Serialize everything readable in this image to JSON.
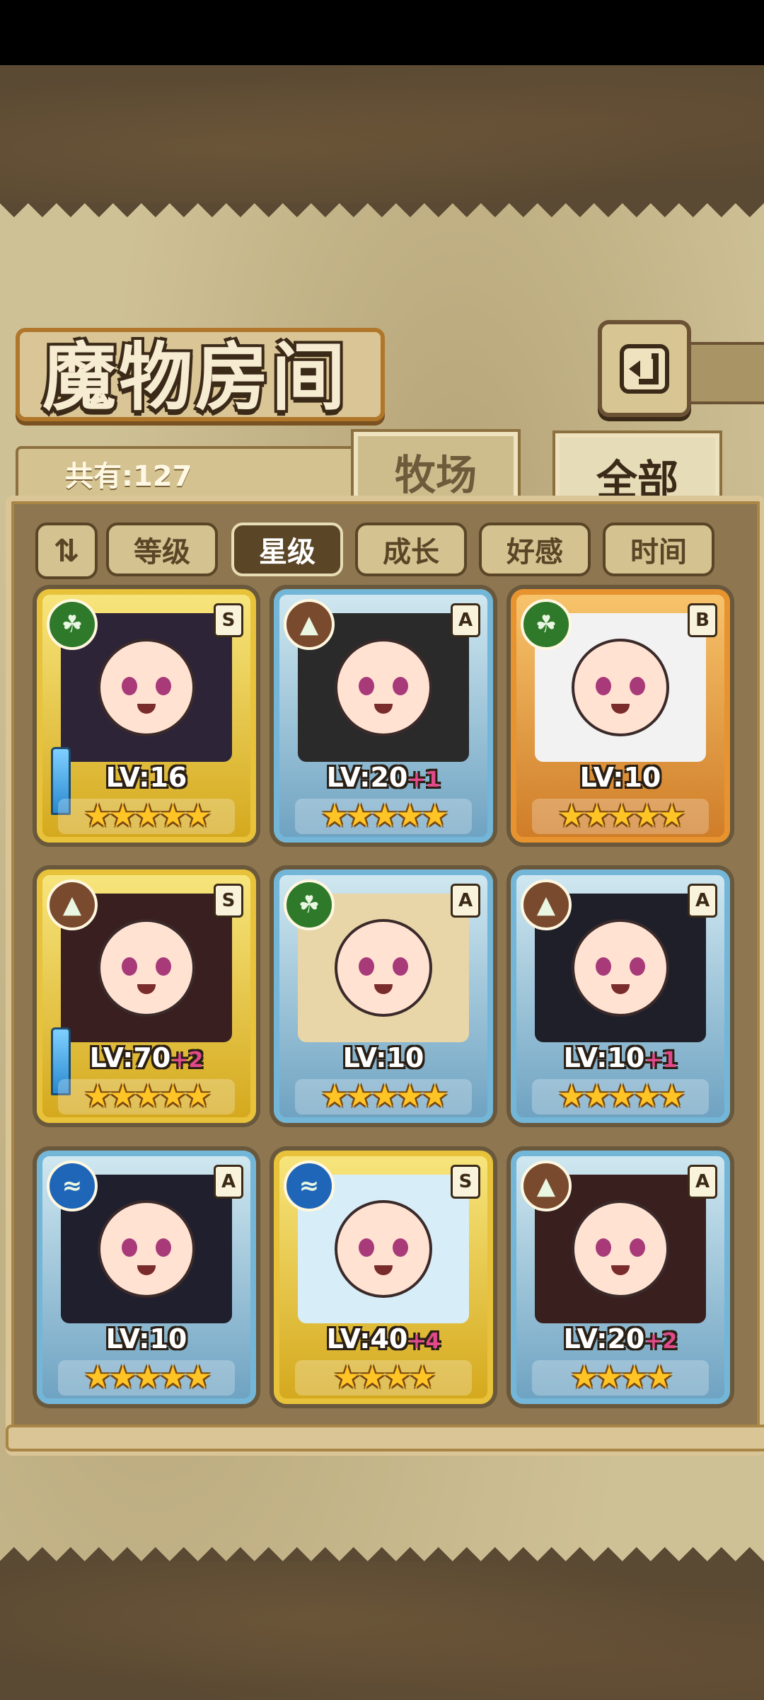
{
  "header": {
    "title": "魔物房间"
  },
  "count_label": "共有:127",
  "tabs": {
    "ranch": "牧场",
    "all": "全部"
  },
  "sort": {
    "toggle_icon": "sort-direction-icon",
    "options": [
      "等级",
      "星级",
      "成长",
      "好感",
      "时间"
    ],
    "active": "星级"
  },
  "monsters": [
    {
      "element": "nature",
      "rank": "S",
      "level": "LV:16",
      "bonus": "",
      "stars": 5,
      "frame": "gold",
      "equipped": true
    },
    {
      "element": "earth",
      "rank": "A",
      "level": "LV:20",
      "bonus": "+1",
      "stars": 5,
      "frame": "blue",
      "equipped": false
    },
    {
      "element": "nature",
      "rank": "B",
      "level": "LV:10",
      "bonus": "",
      "stars": 5,
      "frame": "bronze",
      "equipped": false
    },
    {
      "element": "earth",
      "rank": "S",
      "level": "LV:70",
      "bonus": "+2",
      "stars": 5,
      "frame": "gold",
      "equipped": true
    },
    {
      "element": "nature",
      "rank": "A",
      "level": "LV:10",
      "bonus": "",
      "stars": 5,
      "frame": "blue",
      "equipped": false
    },
    {
      "element": "earth",
      "rank": "A",
      "level": "LV:10",
      "bonus": "+1",
      "stars": 5,
      "frame": "blue",
      "equipped": false
    },
    {
      "element": "water",
      "rank": "A",
      "level": "LV:10",
      "bonus": "",
      "stars": 5,
      "frame": "blue",
      "equipped": false
    },
    {
      "element": "water",
      "rank": "S",
      "level": "LV:40",
      "bonus": "+4",
      "stars": 4,
      "frame": "gold",
      "equipped": false
    },
    {
      "element": "earth",
      "rank": "A",
      "level": "LV:20",
      "bonus": "+2",
      "stars": 4,
      "frame": "blue",
      "equipped": false
    }
  ],
  "element_icons": {
    "nature": "leaf-icon",
    "earth": "mountain-icon",
    "water": "waves-icon"
  },
  "colors": {
    "gold": "#e7c23a",
    "blue": "#73b6d8",
    "bronze": "#e7932f",
    "level_bonus": "#e04a8a",
    "star": "#ffc426"
  }
}
